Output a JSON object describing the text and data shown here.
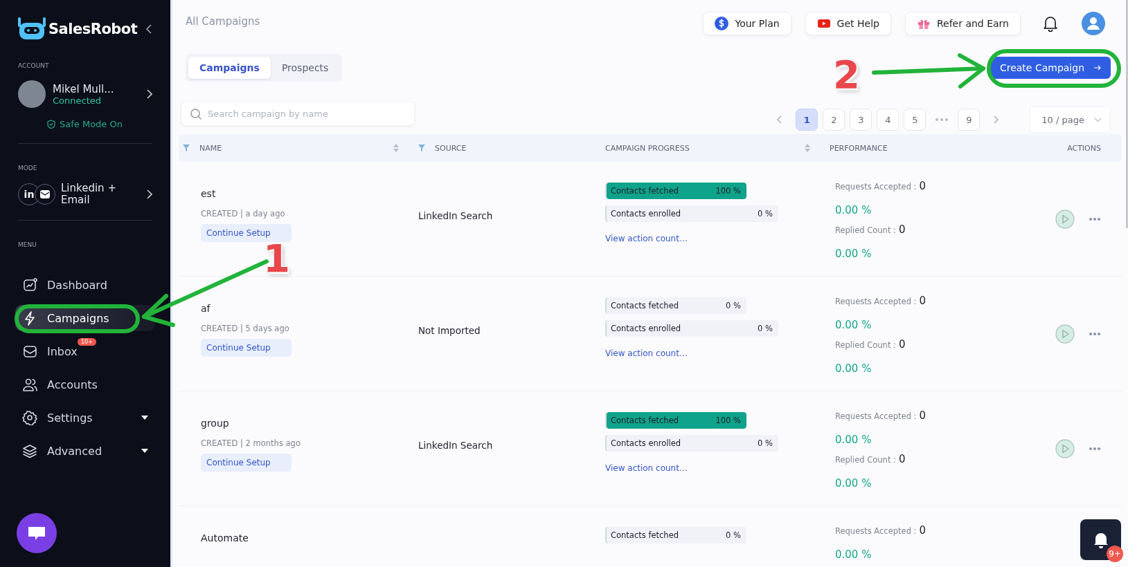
{
  "sidebar": {
    "brand": "SalesRobot",
    "account_label": "ACCOUNT",
    "account": {
      "name": "Mikel Mull...",
      "status": "Connected",
      "safe_mode": "Safe Mode On"
    },
    "mode_label": "MODE",
    "mode": {
      "icon_text": "in",
      "label": "Linkedin + Email"
    },
    "menu_label": "MENU",
    "menu": [
      {
        "label": "Dashboard",
        "selected": false,
        "expandable": false
      },
      {
        "label": "Campaigns",
        "selected": true,
        "expandable": false
      },
      {
        "label": "Inbox",
        "selected": false,
        "expandable": false,
        "badge": "10+"
      },
      {
        "label": "Accounts",
        "selected": false,
        "expandable": false
      },
      {
        "label": "Settings",
        "selected": false,
        "expandable": true
      },
      {
        "label": "Advanced",
        "selected": false,
        "expandable": true
      }
    ]
  },
  "header": {
    "title": "All Campaigns",
    "buttons": [
      {
        "label": "Your Plan"
      },
      {
        "label": "Get Help"
      },
      {
        "label": "Refer and Earn"
      }
    ]
  },
  "tabs": [
    {
      "label": "Campaigns",
      "selected": true
    },
    {
      "label": "Prospects",
      "selected": false
    }
  ],
  "create_button": "Create Campaign",
  "search": {
    "placeholder": "Search campaign by name"
  },
  "pagination": {
    "pages": [
      {
        "kind": "page",
        "label": "1",
        "selected": true
      },
      {
        "kind": "page",
        "label": "2",
        "selected": false
      },
      {
        "kind": "page",
        "label": "3",
        "selected": false
      },
      {
        "kind": "page",
        "label": "4",
        "selected": false
      },
      {
        "kind": "page",
        "label": "5",
        "selected": false
      },
      {
        "kind": "ellipsis"
      },
      {
        "kind": "page",
        "label": "9",
        "selected": false
      }
    ],
    "page_size": "10 / page"
  },
  "table": {
    "columns": [
      {
        "label": "NAME",
        "filter": true,
        "sort": true
      },
      {
        "label": "SOURCE",
        "filter": true,
        "sort": false
      },
      {
        "label": "CAMPAIGN PROGRESS",
        "filter": false,
        "sort": true
      },
      {
        "label": "PERFORMANCE",
        "filter": false,
        "sort": false
      },
      {
        "label": "ACTIONS",
        "filter": false,
        "sort": false
      }
    ],
    "rows": [
      {
        "name": "est",
        "created": "CREATED | a day ago",
        "action": "Continue Setup",
        "source": "LinkedIn Search",
        "progress": [
          {
            "label": "Contacts fetched",
            "value": "100 %",
            "level": 1
          },
          {
            "label": "Contacts enrolled",
            "value": "0 %",
            "level": 0
          }
        ],
        "link": "View action count…",
        "performance": [
          {
            "kind": "count",
            "label": "Requests Accepted :",
            "value": "0"
          },
          {
            "kind": "percent",
            "value": "0.00 %"
          },
          {
            "kind": "count",
            "label": "Replied Count :",
            "value": "0"
          },
          {
            "kind": "percent",
            "value": "0.00 %"
          }
        ]
      },
      {
        "name": "af",
        "created": "CREATED | 5 days ago",
        "action": "Continue Setup",
        "source": "Not Imported",
        "progress": [
          {
            "label": "Contacts fetched",
            "value": "0 %",
            "level": 0
          },
          {
            "label": "Contacts enrolled",
            "value": "0 %",
            "level": 0
          }
        ],
        "link": "View action count…",
        "performance": [
          {
            "kind": "count",
            "label": "Requests Accepted :",
            "value": "0"
          },
          {
            "kind": "percent",
            "value": "0.00 %"
          },
          {
            "kind": "count",
            "label": "Replied Count :",
            "value": "0"
          },
          {
            "kind": "percent",
            "value": "0.00 %"
          }
        ]
      },
      {
        "name": "group",
        "created": "CREATED | 2 months ago",
        "action": "Continue Setup",
        "source": "LinkedIn Search",
        "progress": [
          {
            "label": "Contacts fetched",
            "value": "100 %",
            "level": 1
          },
          {
            "label": "Contacts enrolled",
            "value": "0 %",
            "level": 0
          }
        ],
        "link": "View action count…",
        "performance": [
          {
            "kind": "count",
            "label": "Requests Accepted :",
            "value": "0"
          },
          {
            "kind": "percent",
            "value": "0.00 %"
          },
          {
            "kind": "count",
            "label": "Replied Count :",
            "value": "0"
          },
          {
            "kind": "percent",
            "value": "0.00 %"
          }
        ]
      },
      {
        "name": "Automate",
        "progress": [
          {
            "label": "Contacts fetched",
            "value": "0 %",
            "level": 0
          }
        ],
        "performance": [
          {
            "kind": "count",
            "label": "Requests Accepted :",
            "value": "0"
          },
          {
            "kind": "percent",
            "value": "0.00 %"
          }
        ]
      }
    ]
  },
  "notifications_badge": "9+",
  "annotations": [
    {
      "label": "1"
    },
    {
      "label": "2"
    }
  ]
}
